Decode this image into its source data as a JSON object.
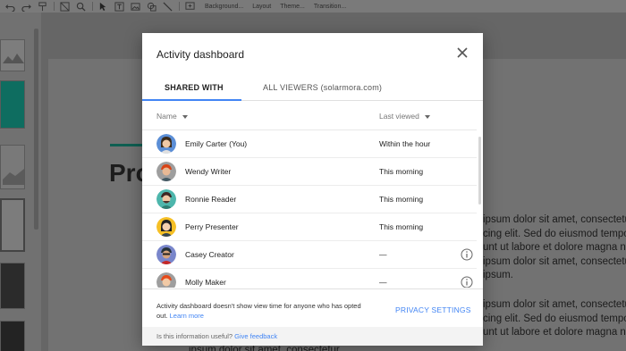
{
  "toolbar": {
    "menus": [
      "Background...",
      "Layout",
      "Theme...",
      "Transition..."
    ]
  },
  "slide": {
    "title": "Pro",
    "body_right_1": "ipsum dolor sit amet, consectetur\ncing elit. Sed do eiusmod tempor\nunt ut labore et dolore magna ne\nipsum dolor sit amet, consectetu\nipsum.",
    "body_right_2": "ipsum dolor sit amet, consectetur\ncing elit. Sed do eiusmod tempor\nunt ut labore et dolore magna ne",
    "body_bottom": "ipsum dolor sit amet, consectetur"
  },
  "dialog": {
    "title": "Activity dashboard",
    "tabs": {
      "shared_with": "SHARED WITH",
      "all_viewers": "ALL VIEWERS (solarmora.com)"
    },
    "columns": {
      "name": "Name",
      "last_viewed": "Last viewed"
    },
    "rows": [
      {
        "name": "Emily Carter (You)",
        "last_viewed": "Within the hour",
        "avatar_color": "#5b8ed6",
        "has_info": false
      },
      {
        "name": "Wendy Writer",
        "last_viewed": "This morning",
        "avatar_color": "#9e9e9e",
        "has_info": false
      },
      {
        "name": "Ronnie Reader",
        "last_viewed": "This morning",
        "avatar_color": "#4db6ac",
        "has_info": false
      },
      {
        "name": "Perry Presenter",
        "last_viewed": "This morning",
        "avatar_color": "#f6c026",
        "has_info": false
      },
      {
        "name": "Casey Creator",
        "last_viewed": "—",
        "avatar_color": "#7986cb",
        "has_info": true
      },
      {
        "name": "Molly Maker",
        "last_viewed": "—",
        "avatar_color": "#9e9e9e",
        "has_info": true
      }
    ],
    "footer": {
      "note": "Activity dashboard doesn't show view time for anyone who has opted out.",
      "learn_more": "Learn more",
      "privacy_settings": "PRIVACY SETTINGS"
    },
    "feedback": {
      "question": "Is this information useful?",
      "link": "Give feedback"
    }
  },
  "colors": {
    "accent": "#4285f4",
    "overlay": "#6f6f6f"
  }
}
